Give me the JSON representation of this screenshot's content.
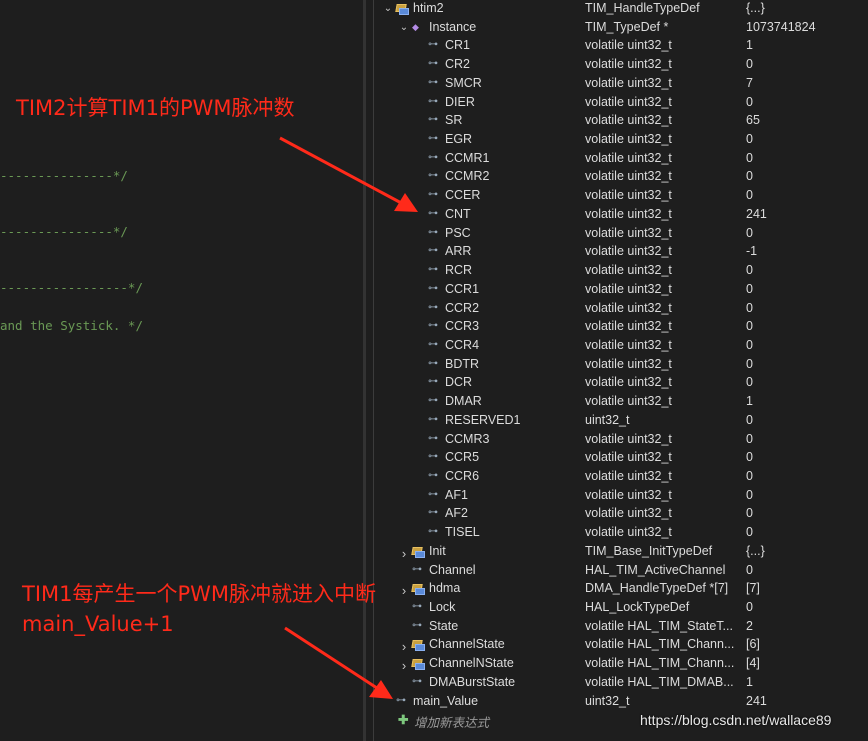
{
  "editor": {
    "lines": [
      "---------------*/",
      "---------------*/",
      "-----------------*/",
      "and the Systick. */"
    ]
  },
  "watch": {
    "rows": [
      {
        "name": "htim2",
        "type": "TIM_HandleTypeDef",
        "value": "{...}",
        "icon": "struct-icon",
        "expander": "expanded",
        "level": 0
      },
      {
        "name": "Instance",
        "type": "TIM_TypeDef *",
        "value": "1073741824",
        "icon": "pointer-icon",
        "expander": "expanded",
        "level": 1
      },
      {
        "name": "CR1",
        "type": "volatile uint32_t",
        "value": "1",
        "icon": "field-icon",
        "level": 2
      },
      {
        "name": "CR2",
        "type": "volatile uint32_t",
        "value": "0",
        "icon": "field-icon",
        "level": 2
      },
      {
        "name": "SMCR",
        "type": "volatile uint32_t",
        "value": "7",
        "icon": "field-icon",
        "level": 2
      },
      {
        "name": "DIER",
        "type": "volatile uint32_t",
        "value": "0",
        "icon": "field-icon",
        "level": 2
      },
      {
        "name": "SR",
        "type": "volatile uint32_t",
        "value": "65",
        "icon": "field-icon",
        "level": 2
      },
      {
        "name": "EGR",
        "type": "volatile uint32_t",
        "value": "0",
        "icon": "field-icon",
        "level": 2
      },
      {
        "name": "CCMR1",
        "type": "volatile uint32_t",
        "value": "0",
        "icon": "field-icon",
        "level": 2
      },
      {
        "name": "CCMR2",
        "type": "volatile uint32_t",
        "value": "0",
        "icon": "field-icon",
        "level": 2
      },
      {
        "name": "CCER",
        "type": "volatile uint32_t",
        "value": "0",
        "icon": "field-icon",
        "level": 2
      },
      {
        "name": "CNT",
        "type": "volatile uint32_t",
        "value": "241",
        "icon": "field-icon",
        "level": 2
      },
      {
        "name": "PSC",
        "type": "volatile uint32_t",
        "value": "0",
        "icon": "field-icon",
        "level": 2
      },
      {
        "name": "ARR",
        "type": "volatile uint32_t",
        "value": "-1",
        "icon": "field-icon",
        "level": 2
      },
      {
        "name": "RCR",
        "type": "volatile uint32_t",
        "value": "0",
        "icon": "field-icon",
        "level": 2
      },
      {
        "name": "CCR1",
        "type": "volatile uint32_t",
        "value": "0",
        "icon": "field-icon",
        "level": 2
      },
      {
        "name": "CCR2",
        "type": "volatile uint32_t",
        "value": "0",
        "icon": "field-icon",
        "level": 2
      },
      {
        "name": "CCR3",
        "type": "volatile uint32_t",
        "value": "0",
        "icon": "field-icon",
        "level": 2
      },
      {
        "name": "CCR4",
        "type": "volatile uint32_t",
        "value": "0",
        "icon": "field-icon",
        "level": 2
      },
      {
        "name": "BDTR",
        "type": "volatile uint32_t",
        "value": "0",
        "icon": "field-icon",
        "level": 2
      },
      {
        "name": "DCR",
        "type": "volatile uint32_t",
        "value": "0",
        "icon": "field-icon",
        "level": 2
      },
      {
        "name": "DMAR",
        "type": "volatile uint32_t",
        "value": "1",
        "icon": "field-icon",
        "level": 2
      },
      {
        "name": "RESERVED1",
        "type": "uint32_t",
        "value": "0",
        "icon": "field-icon",
        "level": 2
      },
      {
        "name": "CCMR3",
        "type": "volatile uint32_t",
        "value": "0",
        "icon": "field-icon",
        "level": 2
      },
      {
        "name": "CCR5",
        "type": "volatile uint32_t",
        "value": "0",
        "icon": "field-icon",
        "level": 2
      },
      {
        "name": "CCR6",
        "type": "volatile uint32_t",
        "value": "0",
        "icon": "field-icon",
        "level": 2
      },
      {
        "name": "AF1",
        "type": "volatile uint32_t",
        "value": "0",
        "icon": "field-icon",
        "level": 2
      },
      {
        "name": "AF2",
        "type": "volatile uint32_t",
        "value": "0",
        "icon": "field-icon",
        "level": 2
      },
      {
        "name": "TISEL",
        "type": "volatile uint32_t",
        "value": "0",
        "icon": "field-icon",
        "level": 2
      },
      {
        "name": "Init",
        "type": "TIM_Base_InitTypeDef",
        "value": "{...}",
        "icon": "struct-icon",
        "expander": "collapsed",
        "level": 1
      },
      {
        "name": "Channel",
        "type": "HAL_TIM_ActiveChannel",
        "value": "0",
        "icon": "field-icon",
        "level": 1
      },
      {
        "name": "hdma",
        "type": "DMA_HandleTypeDef *[7]",
        "value": "[7]",
        "icon": "struct-icon",
        "expander": "collapsed",
        "level": 1
      },
      {
        "name": "Lock",
        "type": "HAL_LockTypeDef",
        "value": "0",
        "icon": "field-icon",
        "level": 1
      },
      {
        "name": "State",
        "type": "volatile HAL_TIM_StateT...",
        "value": "2",
        "icon": "field-icon",
        "level": 1
      },
      {
        "name": "ChannelState",
        "type": "volatile HAL_TIM_Chann...",
        "value": "[6]",
        "icon": "struct-icon",
        "expander": "collapsed",
        "level": 1
      },
      {
        "name": "ChannelNState",
        "type": "volatile HAL_TIM_Chann...",
        "value": "[4]",
        "icon": "struct-icon",
        "expander": "collapsed",
        "level": 1
      },
      {
        "name": "DMABurstState",
        "type": "volatile HAL_TIM_DMAB...",
        "value": "1",
        "icon": "field-icon",
        "level": 1
      },
      {
        "name": "main_Value",
        "type": "uint32_t",
        "value": "241",
        "icon": "field-icon",
        "level": 0
      }
    ],
    "add_expression": "增加新表达式"
  },
  "annotations": {
    "top": "TIM2计算TIM1的PWM脉冲数",
    "bottom_line1": "TIM1每产生一个PWM脉冲就进入中断",
    "bottom_line2": "main_Value+1"
  },
  "colors": {
    "annotation": "#ff2a1a",
    "comment": "#6a9955",
    "background": "#1e1e1e"
  },
  "watermark": "https://blog.csdn.net/wallace89"
}
